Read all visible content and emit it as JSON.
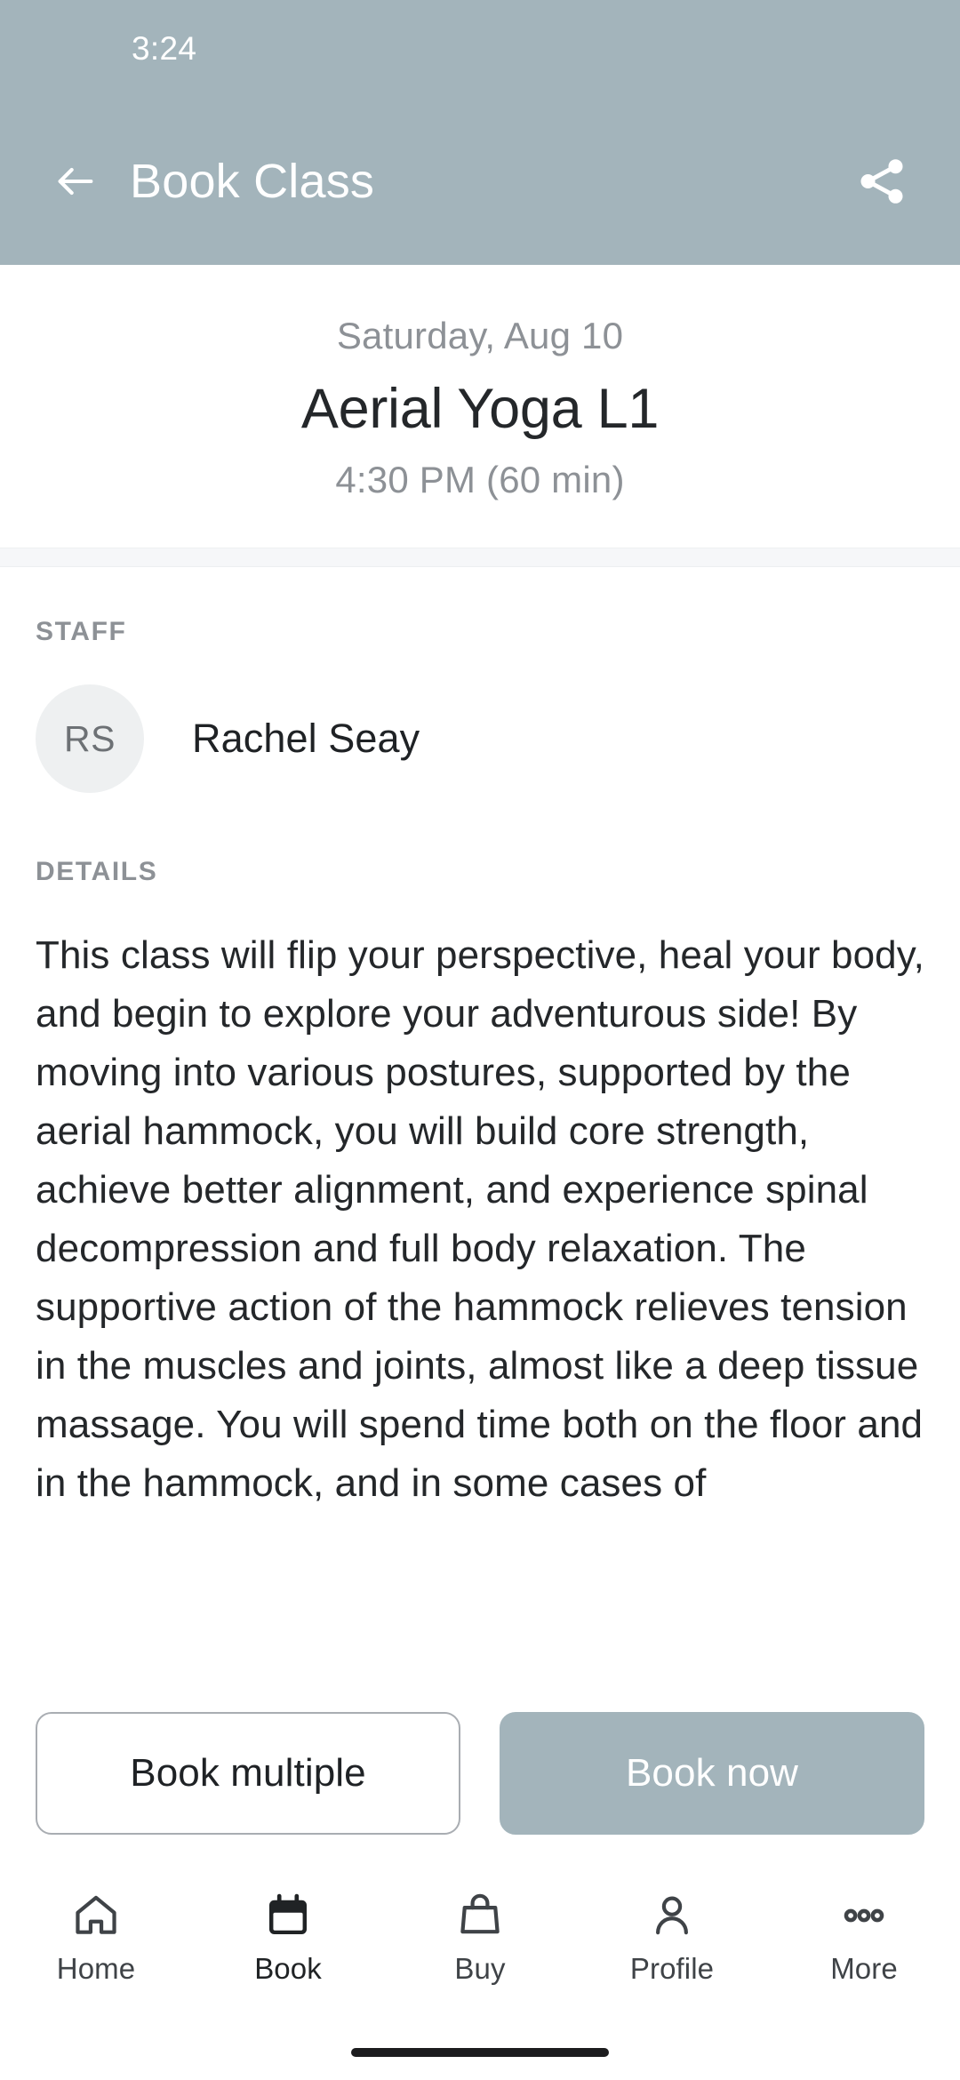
{
  "status_bar": {
    "time": "3:24"
  },
  "app_bar": {
    "title": "Book Class",
    "back_icon": "arrow-left-icon",
    "share_icon": "share-icon"
  },
  "class_header": {
    "date": "Saturday, Aug 10",
    "name": "Aerial Yoga L1",
    "time": "4:30 PM (60 min)"
  },
  "staff_section": {
    "label": "STAFF",
    "members": [
      {
        "initials": "RS",
        "name": "Rachel Seay"
      }
    ]
  },
  "details_section": {
    "label": "DETAILS",
    "text": "This class will flip your perspective, heal your body, and begin to explore your adventurous side! By moving into various postures, supported by the aerial hammock, you will build core strength, achieve better alignment, and experience spinal decompression and full body relaxation. The supportive action of the hammock relieves tension in the muscles and joints, almost like a deep tissue massage. You will spend time both on the floor and in the hammock, and in some cases of"
  },
  "actions": {
    "secondary_label": "Book multiple",
    "primary_label": "Book now"
  },
  "bottom_nav": {
    "items": [
      {
        "label": "Home",
        "icon": "home-icon",
        "active": false
      },
      {
        "label": "Book",
        "icon": "calendar-icon",
        "active": true
      },
      {
        "label": "Buy",
        "icon": "bag-icon",
        "active": false
      },
      {
        "label": "Profile",
        "icon": "person-icon",
        "active": false
      },
      {
        "label": "More",
        "icon": "ellipsis-icon",
        "active": false
      }
    ]
  },
  "colors": {
    "brand": "#a3b4bb",
    "text_primary": "#24272a",
    "text_muted": "#8d9196",
    "avatar_bg": "#eef0f1"
  }
}
